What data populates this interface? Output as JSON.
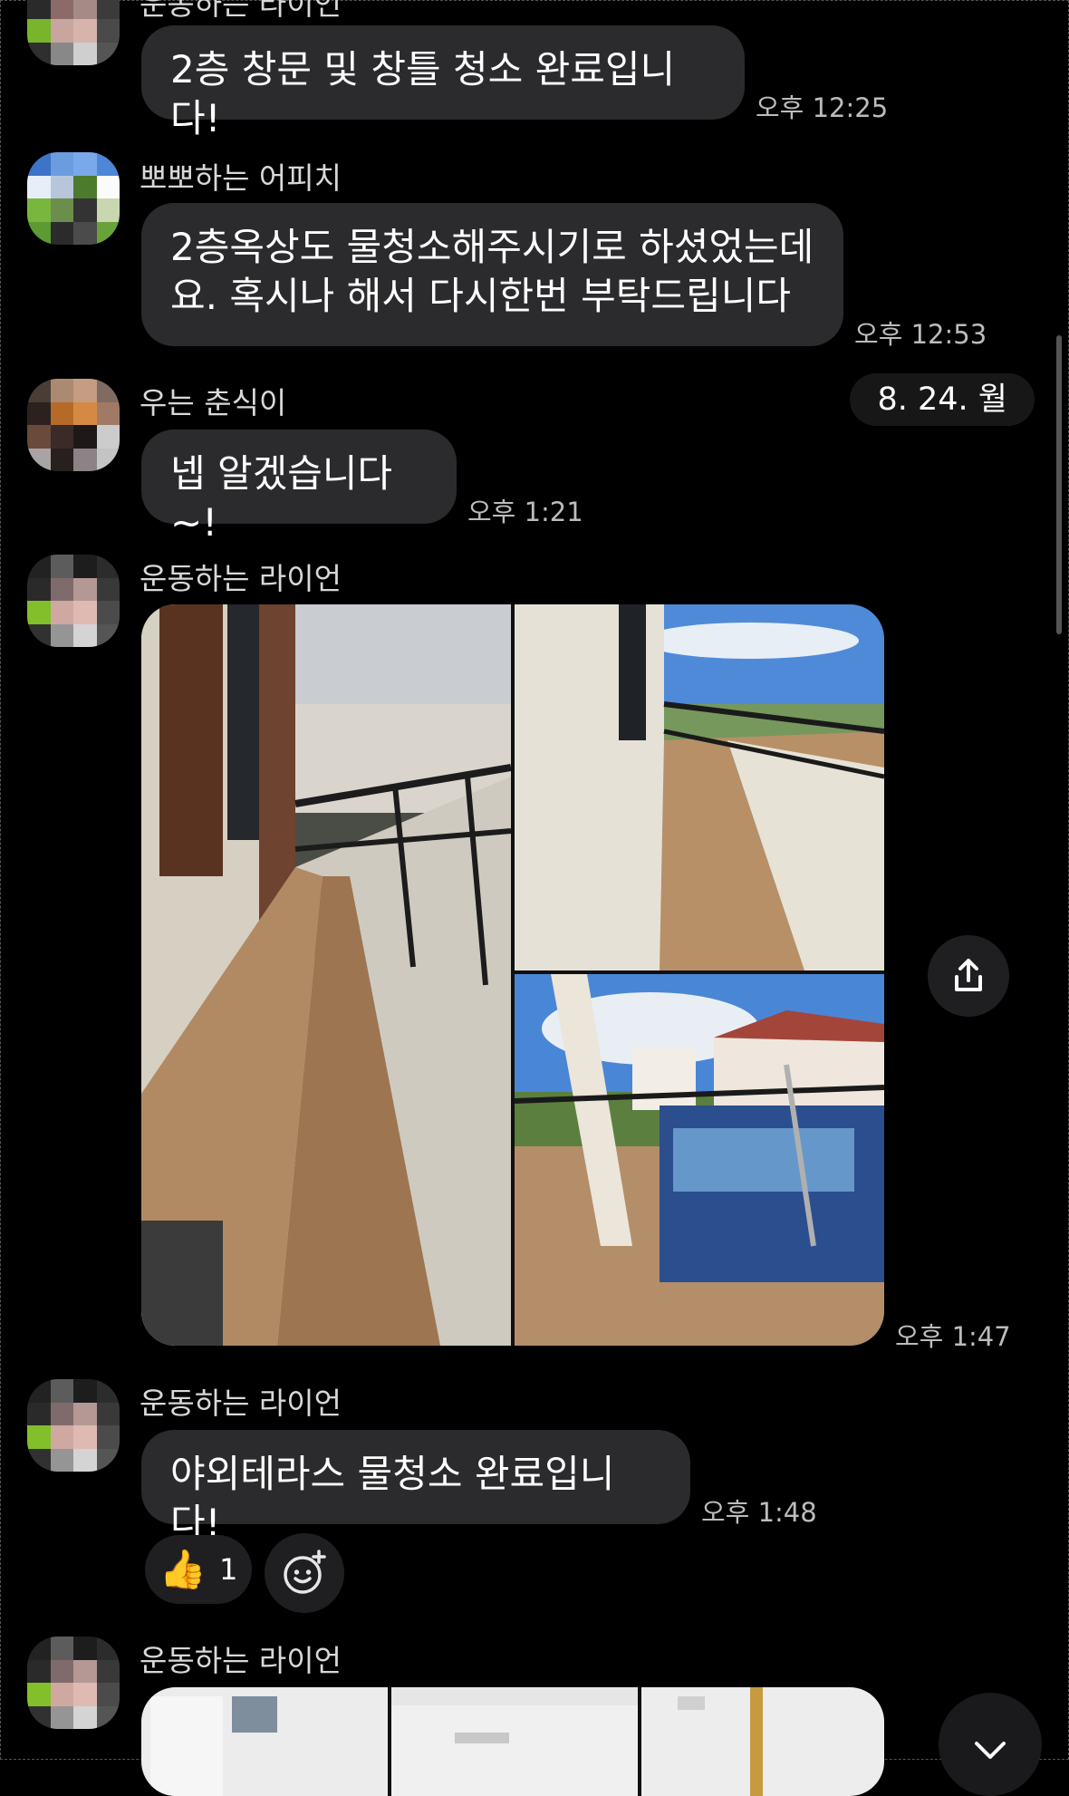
{
  "messages": [
    {
      "sender": "운동하는 라이언",
      "text": "2층 창문 및 창틀 청소 완료입니다!",
      "time": "오후 12:25"
    },
    {
      "sender": "뽀뽀하는 어피치",
      "text_line1": "2층옥상도 물청소해주시기로 하셨었는데",
      "text_line2": "요. 혹시나 해서 다시한번 부탁드립니다",
      "time": "오후 12:53"
    },
    {
      "sender": "우는 춘식이",
      "text": "넵 알겠습니다~!",
      "time": "오후 1:21"
    },
    {
      "sender": "운동하는 라이언",
      "type": "photos",
      "time": "오후 1:47"
    },
    {
      "sender": "운동하는 라이언",
      "text": "야외테라스 물청소 완료입니다!",
      "time": "오후 1:48",
      "reaction_count": "1"
    },
    {
      "sender": "운동하는 라이언",
      "type": "photos"
    }
  ],
  "date_chip": "8. 24. 월",
  "icons": {
    "share": "share-icon",
    "thumbs_up": "thumbs-up-icon",
    "add_reaction": "add-reaction-icon",
    "scroll_down": "chevron-down-icon"
  },
  "colors": {
    "background": "#000000",
    "bubble": "#2b2b2d",
    "time": "#bcbcbc"
  }
}
